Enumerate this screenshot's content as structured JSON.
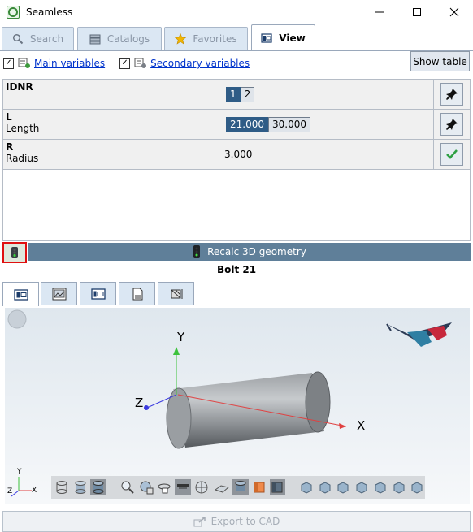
{
  "window": {
    "title": "Seamless",
    "minimize_icon": "minimize-icon",
    "maximize_icon": "maximize-icon",
    "close_icon": "close-icon"
  },
  "tabs": [
    {
      "label": "Search",
      "icon": "search-icon"
    },
    {
      "label": "Catalogs",
      "icon": "catalogs-icon"
    },
    {
      "label": "Favorites",
      "icon": "star-icon"
    },
    {
      "label": "View",
      "icon": "view-icon"
    }
  ],
  "header_icons": [
    "key-icon",
    "gear-icon"
  ],
  "variables": {
    "main_label": "Main variables",
    "main_checked": true,
    "secondary_label": "Secondary variables",
    "secondary_checked": true,
    "show_table_label": "Show table"
  },
  "table": {
    "rows": [
      {
        "name": "IDNR",
        "desc": "",
        "values": [
          "1",
          "2"
        ],
        "selected": 0,
        "action_icon": "pin-icon"
      },
      {
        "name": "L",
        "desc": "Length",
        "values": [
          "21.000",
          "30.000"
        ],
        "selected": 0,
        "action_icon": "pin-icon"
      },
      {
        "name": "R",
        "desc": "Radius",
        "values": [
          "3.000"
        ],
        "selected": -1,
        "action_icon": "checkmark-icon"
      }
    ]
  },
  "recalc": {
    "label": "Recalc 3D geometry"
  },
  "part_title": "Bolt 21",
  "view_tabs": [
    "view-3d-icon",
    "view-image-icon",
    "view-table-icon",
    "view-print-icon",
    "view-dimension-icon"
  ],
  "viewer": {
    "axis_x": "X",
    "axis_y": "Y",
    "axis_z": "Z",
    "corner_axis_x": "X",
    "corner_axis_y": "Y",
    "corner_axis_z": "Z"
  },
  "export": {
    "label": "Export to CAD"
  },
  "colors": {
    "selected_chip": "#2f5c86",
    "recalc_bar": "#5f7f99",
    "highlight_border": "#e01010"
  }
}
